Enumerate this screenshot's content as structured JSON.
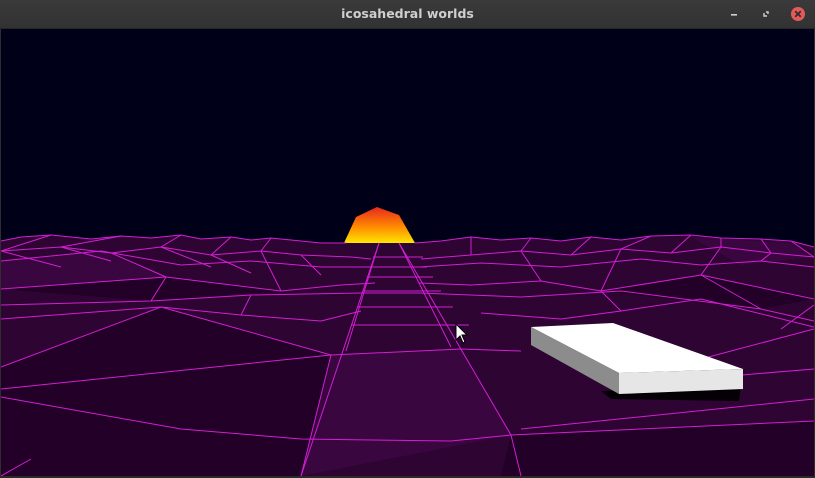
{
  "window": {
    "title": "icosahedral worlds",
    "controls": {
      "minimize_icon": "minimize-icon",
      "maximize_icon": "restore-icon",
      "close_icon": "close-icon"
    }
  },
  "scene": {
    "colors": {
      "sky": "#000018",
      "ground": "#2e0433",
      "grid": "#d21ed2",
      "sun_top": "#e8281e",
      "sun_bottom": "#ffe600",
      "ship_top": "#ffffff",
      "ship_side": "#8c8c8c",
      "ship_front": "#e6e6e6",
      "ship_shadow": "#000000"
    }
  }
}
